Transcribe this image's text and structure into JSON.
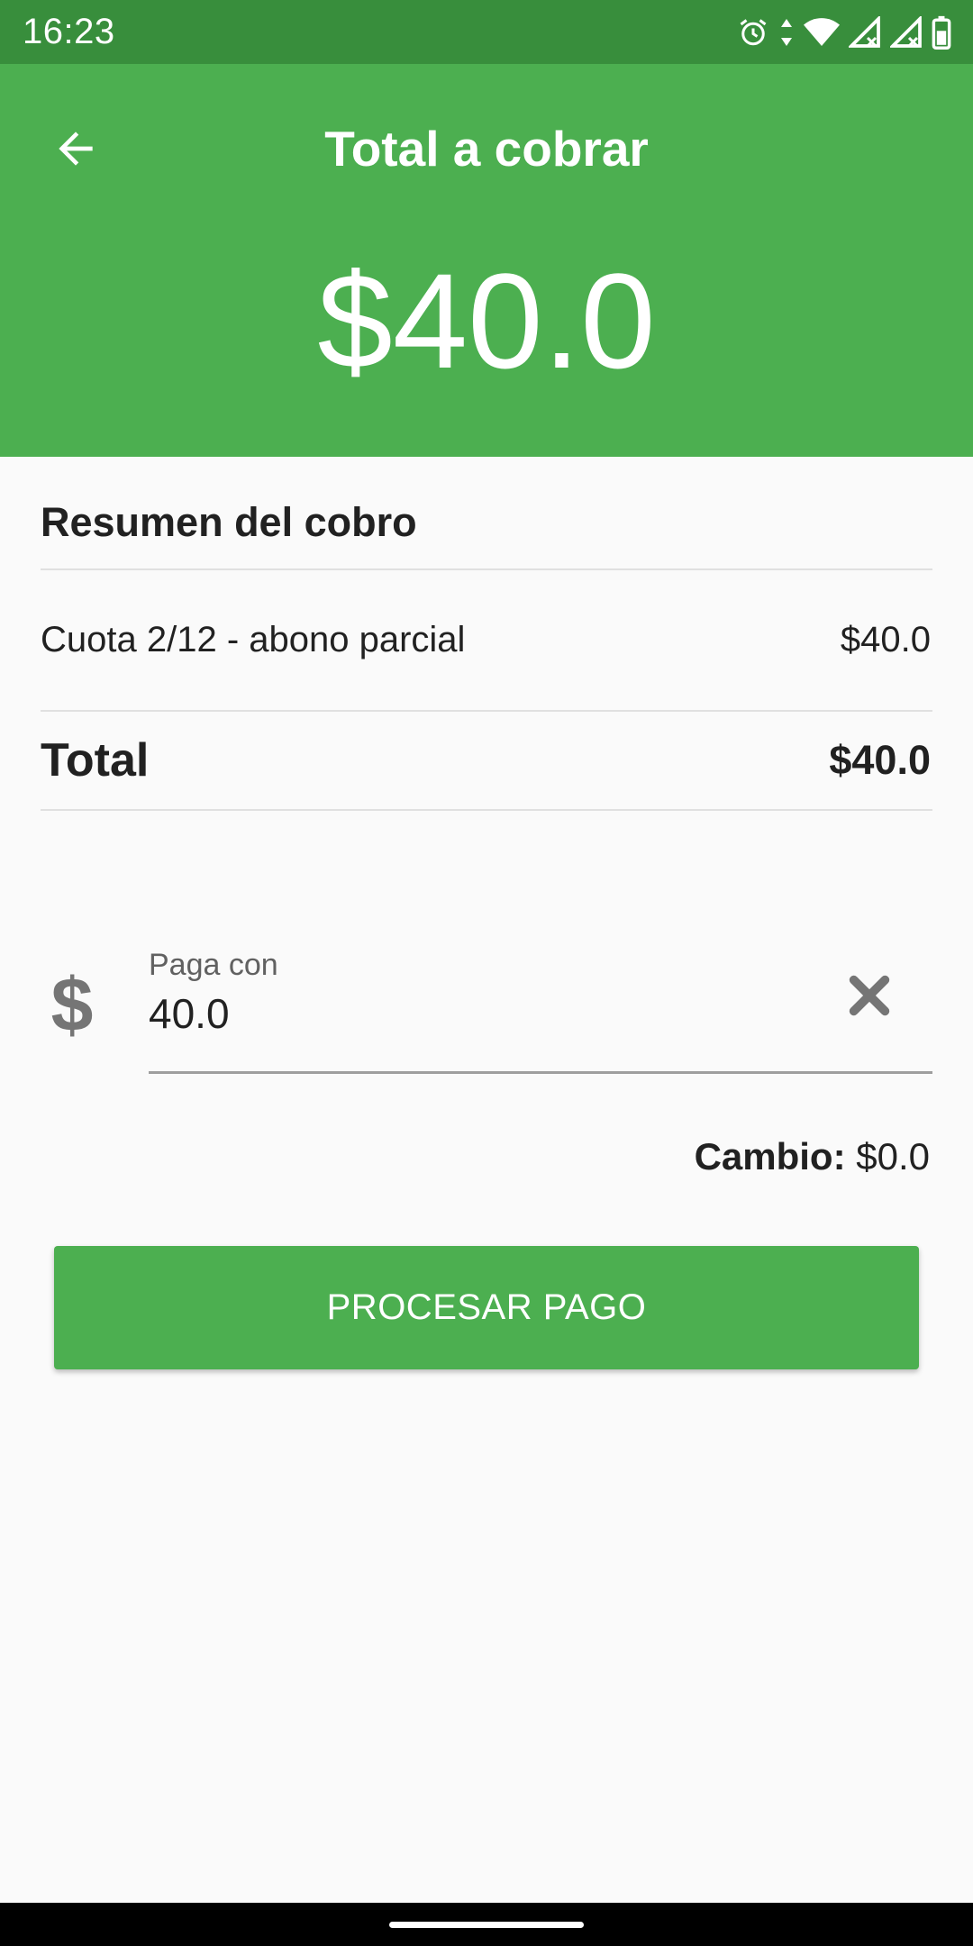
{
  "status_bar": {
    "time": "16:23",
    "icons": [
      "alarm-icon",
      "data-arrows-icon",
      "wifi-icon",
      "signal-icon",
      "signal-icon",
      "battery-icon"
    ]
  },
  "header": {
    "title": "Total a cobrar",
    "amount": "$40.0",
    "back_icon": "arrow-left-icon",
    "background_color": "#4caf50",
    "status_color": "#388e3c"
  },
  "summary": {
    "title": "Resumen del cobro",
    "items": [
      {
        "label": "Cuota 2/12 - abono parcial",
        "amount": "$40.0"
      }
    ],
    "total_label": "Total",
    "total_value": "$40.0"
  },
  "payment": {
    "icon": "dollar-icon",
    "icon_glyph": "$",
    "label": "Paga con",
    "value": "40.0",
    "clear_icon": "close-icon"
  },
  "change": {
    "label": "Cambio:",
    "value": "$0.0"
  },
  "actions": {
    "process_label": "PROCESAR PAGO"
  }
}
